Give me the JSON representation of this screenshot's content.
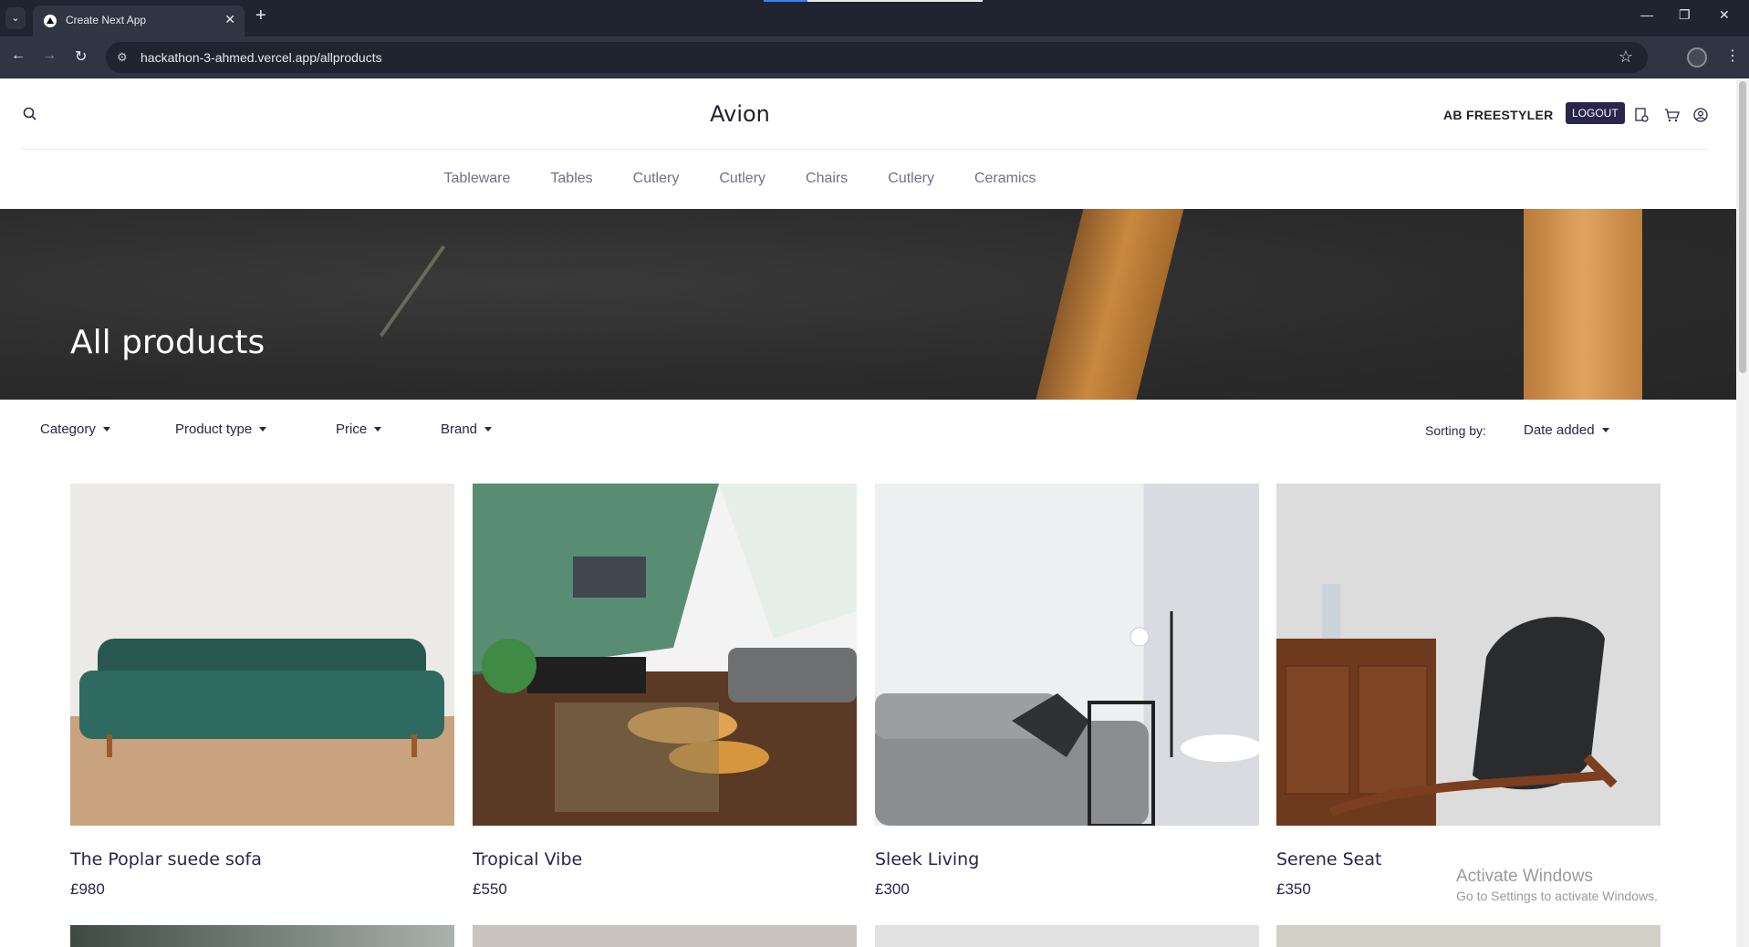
{
  "browser": {
    "tab_title": "Create Next App",
    "url": "hackathon-3-ahmed.vercel.app/allproducts"
  },
  "header": {
    "brand": "Avion",
    "user": "AB FREESTYLER",
    "logout_label": "LOGOUT"
  },
  "nav": {
    "categories": [
      "Tableware",
      "Tables",
      "Cutlery",
      "Cutlery",
      "Chairs",
      "Cutlery",
      "Ceramics"
    ]
  },
  "hero": {
    "title": "All products"
  },
  "filters": {
    "category": "Category",
    "product_type": "Product type",
    "price": "Price",
    "brand": "Brand",
    "sort_label": "Sorting by:",
    "sort_value": "Date added"
  },
  "products": [
    {
      "name": "The Poplar suede sofa",
      "price": "£980"
    },
    {
      "name": "Tropical Vibe",
      "price": "£550"
    },
    {
      "name": "Sleek Living",
      "price": "£300"
    },
    {
      "name": "Serene Seat",
      "price": "£350"
    }
  ],
  "watermark": {
    "title": "Activate Windows",
    "subtitle": "Go to Settings to activate Windows."
  },
  "colors": {
    "primary": "#2a254b",
    "nav_text": "#726e8d",
    "browser_chrome": "#1f2430"
  }
}
